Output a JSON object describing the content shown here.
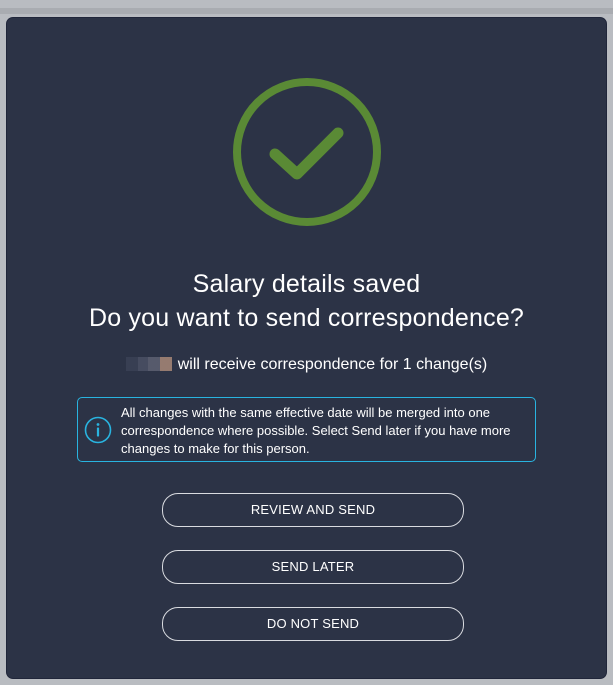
{
  "dialog": {
    "title_line1": "Salary details saved",
    "title_line2": "Do you want to send correspondence?",
    "recipient_text": "will receive correspondence for 1 change(s)",
    "info_text": "All changes with the same effective date will be merged into one correspondence where possible. Select Send later if you have more changes to make for this person.",
    "buttons": {
      "review_and_send": "REVIEW AND SEND",
      "send_later": "SEND LATER",
      "do_not_send": "DO NOT SEND"
    }
  },
  "icons": {
    "success": "check-circle-icon",
    "info": "info-circle-icon"
  },
  "colors": {
    "modal_background": "#2c3346",
    "success_green": "#5a8a35",
    "info_border": "#29b4e0",
    "text": "#ffffff"
  }
}
